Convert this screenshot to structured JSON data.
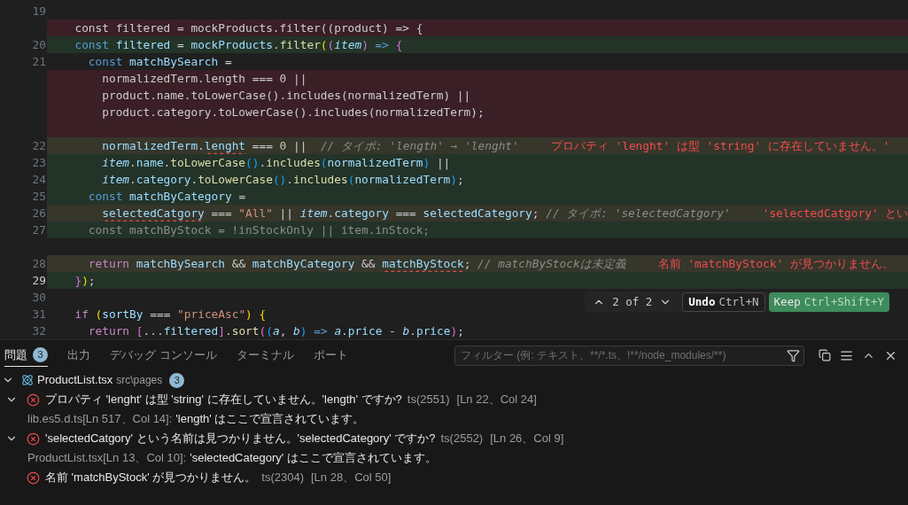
{
  "editor": {
    "lines": [
      {
        "number": "19",
        "kind": "plain",
        "current": false
      },
      {
        "kind": "deleted",
        "segments": [
          {
            "text": "  const filtered = mockProducts.filter((product) => {",
            "kind": "plain"
          }
        ]
      },
      {
        "number": "20",
        "kind": "added",
        "current": false,
        "segments": [
          {
            "text": "  const",
            "kind": "kw"
          },
          {
            "text": " filtered",
            "kind": "var"
          },
          {
            "text": " = ",
            "kind": "plain"
          },
          {
            "text": "mockProducts",
            "kind": "var"
          },
          {
            "text": ".",
            "kind": "plain"
          },
          {
            "text": "filter",
            "kind": "fn"
          },
          {
            "text": "(",
            "kind": "p1"
          },
          {
            "text": "(",
            "kind": "p2"
          },
          {
            "text": "item",
            "kind": "param"
          },
          {
            "text": ")",
            "kind": "p2"
          },
          {
            "text": " => ",
            "kind": "kw"
          },
          {
            "text": "{",
            "kind": "p2"
          }
        ]
      },
      {
        "number": "21",
        "kind": "plain",
        "current": false,
        "segments": [
          {
            "text": "    const",
            "kind": "kw"
          },
          {
            "text": " matchBySearch",
            "kind": "var"
          },
          {
            "text": " =",
            "kind": "plain"
          }
        ]
      },
      {
        "kind": "deleted",
        "segments": [
          {
            "text": "      normalizedTerm.length === 0 ||",
            "kind": "plain"
          }
        ]
      },
      {
        "kind": "deleted",
        "segments": [
          {
            "text": "      product.name.toLowerCase().includes(normalizedTerm) ||",
            "kind": "plain"
          }
        ]
      },
      {
        "kind": "deleted",
        "segments": [
          {
            "text": "      product.category.toLowerCase().includes(normalizedTerm);",
            "kind": "plain"
          }
        ]
      },
      {
        "kind": "deleted"
      },
      {
        "number": "22",
        "kind": "modified",
        "current": false,
        "segments": [
          {
            "text": "      normalizedTerm",
            "kind": "var"
          },
          {
            "text": ".",
            "kind": "plain"
          },
          {
            "text": "lenght",
            "kind": "var",
            "squiggle": true
          },
          {
            "text": " === ",
            "kind": "plain"
          },
          {
            "text": "0",
            "kind": "num"
          },
          {
            "text": " ||  ",
            "kind": "plain"
          },
          {
            "text": "// タイポ: 'length' → 'lenght'",
            "kind": "cmt"
          }
        ],
        "diagnostic": "プロパティ 'lenght' は型 'string' に存在していません。'"
      },
      {
        "number": "23",
        "kind": "added",
        "current": false,
        "segments": [
          {
            "text": "      item",
            "kind": "param"
          },
          {
            "text": ".",
            "kind": "plain"
          },
          {
            "text": "name",
            "kind": "var"
          },
          {
            "text": ".",
            "kind": "plain"
          },
          {
            "text": "toLowerCase",
            "kind": "fn"
          },
          {
            "text": "()",
            "kind": "p3"
          },
          {
            "text": ".",
            "kind": "plain"
          },
          {
            "text": "includes",
            "kind": "fn"
          },
          {
            "text": "(",
            "kind": "p3"
          },
          {
            "text": "normalizedTerm",
            "kind": "var"
          },
          {
            "text": ")",
            "kind": "p3"
          },
          {
            "text": " ||",
            "kind": "plain"
          }
        ]
      },
      {
        "number": "24",
        "kind": "added",
        "current": false,
        "segments": [
          {
            "text": "      item",
            "kind": "param"
          },
          {
            "text": ".",
            "kind": "plain"
          },
          {
            "text": "category",
            "kind": "var"
          },
          {
            "text": ".",
            "kind": "plain"
          },
          {
            "text": "toLowerCase",
            "kind": "fn"
          },
          {
            "text": "()",
            "kind": "p3"
          },
          {
            "text": ".",
            "kind": "plain"
          },
          {
            "text": "includes",
            "kind": "fn"
          },
          {
            "text": "(",
            "kind": "p3"
          },
          {
            "text": "normalizedTerm",
            "kind": "var"
          },
          {
            "text": ")",
            "kind": "p3"
          },
          {
            "text": ";",
            "kind": "plain"
          }
        ]
      },
      {
        "number": "25",
        "kind": "added",
        "current": false,
        "segments": [
          {
            "text": "    const",
            "kind": "kw"
          },
          {
            "text": " matchByCategory",
            "kind": "var"
          },
          {
            "text": " =",
            "kind": "plain"
          }
        ]
      },
      {
        "number": "26",
        "kind": "modified",
        "current": false,
        "segments": [
          {
            "text": "      selectedCatgory",
            "kind": "var",
            "squiggle": true
          },
          {
            "text": " === ",
            "kind": "plain"
          },
          {
            "text": "\"All\"",
            "kind": "str"
          },
          {
            "text": " || ",
            "kind": "plain"
          },
          {
            "text": "item",
            "kind": "param"
          },
          {
            "text": ".",
            "kind": "plain"
          },
          {
            "text": "category",
            "kind": "var"
          },
          {
            "text": " === ",
            "kind": "plain"
          },
          {
            "text": "selectedCategory",
            "kind": "var"
          },
          {
            "text": "; ",
            "kind": "plain"
          },
          {
            "text": "// タイポ: 'selectedCatgory'",
            "kind": "cmt"
          }
        ],
        "diagnostic": "'selectedCatgory' とい"
      },
      {
        "number": "27",
        "kind": "added",
        "current": false,
        "segments": [
          {
            "text": "    const matchByStock = !inStockOnly || item.inStock;",
            "kind": "dim"
          }
        ]
      },
      {
        "kind": "plain"
      },
      {
        "number": "28",
        "kind": "modified",
        "current": false,
        "segments": [
          {
            "text": "    return",
            "kind": "ctl"
          },
          {
            "text": " matchBySearch",
            "kind": "var"
          },
          {
            "text": " && ",
            "kind": "plain"
          },
          {
            "text": "matchByCategory",
            "kind": "var"
          },
          {
            "text": " && ",
            "kind": "plain"
          },
          {
            "text": "matchByStock",
            "kind": "var",
            "squiggle": true
          },
          {
            "text": "; ",
            "kind": "plain"
          },
          {
            "text": "// matchByStockは未定義",
            "kind": "cmt"
          }
        ],
        "diagnostic": "名前 'matchByStock' が見つかりません。"
      },
      {
        "number": "29",
        "kind": "added",
        "current": true,
        "segments": [
          {
            "text": "  }",
            "kind": "p2"
          },
          {
            "text": ")",
            "kind": "p1"
          },
          {
            "text": ";",
            "kind": "plain"
          }
        ]
      },
      {
        "number": "30",
        "kind": "plain",
        "current": false
      },
      {
        "number": "31",
        "kind": "plain",
        "current": false,
        "segments": [
          {
            "text": "  if",
            "kind": "ctl"
          },
          {
            "text": " (",
            "kind": "p1"
          },
          {
            "text": "sortBy",
            "kind": "var"
          },
          {
            "text": " === ",
            "kind": "plain"
          },
          {
            "text": "\"priceAsc\"",
            "kind": "str"
          },
          {
            "text": ")",
            "kind": "p1"
          },
          {
            "text": " {",
            "kind": "p1"
          }
        ]
      },
      {
        "number": "32",
        "kind": "plain",
        "current": false,
        "segments": [
          {
            "text": "    return",
            "kind": "ctl"
          },
          {
            "text": " [",
            "kind": "p2"
          },
          {
            "text": "...",
            "kind": "plain"
          },
          {
            "text": "filtered",
            "kind": "var"
          },
          {
            "text": "]",
            "kind": "p2"
          },
          {
            "text": ".",
            "kind": "plain"
          },
          {
            "text": "sort",
            "kind": "fn"
          },
          {
            "text": "(",
            "kind": "p2"
          },
          {
            "text": "(",
            "kind": "p3"
          },
          {
            "text": "a",
            "kind": "param"
          },
          {
            "text": ", ",
            "kind": "plain"
          },
          {
            "text": "b",
            "kind": "param"
          },
          {
            "text": ")",
            "kind": "p3"
          },
          {
            "text": " => ",
            "kind": "kw"
          },
          {
            "text": "a",
            "kind": "param"
          },
          {
            "text": ".",
            "kind": "plain"
          },
          {
            "text": "price",
            "kind": "var"
          },
          {
            "text": " - ",
            "kind": "plain"
          },
          {
            "text": "b",
            "kind": "param"
          },
          {
            "text": ".",
            "kind": "plain"
          },
          {
            "text": "price",
            "kind": "var"
          },
          {
            "text": ")",
            "kind": "p2"
          },
          {
            "text": ";",
            "kind": "plain"
          }
        ]
      }
    ],
    "review": {
      "position": "2 of 2",
      "undo": {
        "label": "Undo",
        "shortcut": "Ctrl+N"
      },
      "keep": {
        "label": "Keep",
        "shortcut": "Ctrl+Shift+Y"
      }
    }
  },
  "panel": {
    "tabs": [
      {
        "label": "問題",
        "count": "3",
        "selected": true
      },
      {
        "label": "出力",
        "selected": false
      },
      {
        "label": "デバッグ コンソール",
        "selected": false
      },
      {
        "label": "ターミナル",
        "selected": false
      },
      {
        "label": "ポート",
        "selected": false
      }
    ],
    "filter": {
      "placeholder": "フィルター (例: テキスト、**/*.ts、!**/node_modules/**)"
    },
    "file": {
      "name": "ProductList.tsx",
      "path": "src\\pages",
      "count": "3",
      "expanded": true,
      "problems": [
        {
          "message": "プロパティ 'lenght' は型 'string' に存在していません。'length' ですか?",
          "code": "ts(2551)",
          "location": "[Ln 22、Col 24]",
          "expanded": true,
          "related": [
            {
              "source": "lib.es5.d.ts[Ln 517、Col 14]:",
              "message": "'length' はここで宣言されています。"
            }
          ]
        },
        {
          "message": "'selectedCatgory' という名前は見つかりません。'selectedCategory' ですか?",
          "code": "ts(2552)",
          "location": "[Ln 26、Col 9]",
          "expanded": true,
          "related": [
            {
              "source": "ProductList.tsx[Ln 13、Col 10]:",
              "message": "'selectedCategory' はここで宣言されています。"
            }
          ]
        },
        {
          "message": "名前 'matchByStock' が見つかりません。",
          "code": "ts(2304)",
          "location": "[Ln 28、Col 50]"
        }
      ]
    }
  }
}
